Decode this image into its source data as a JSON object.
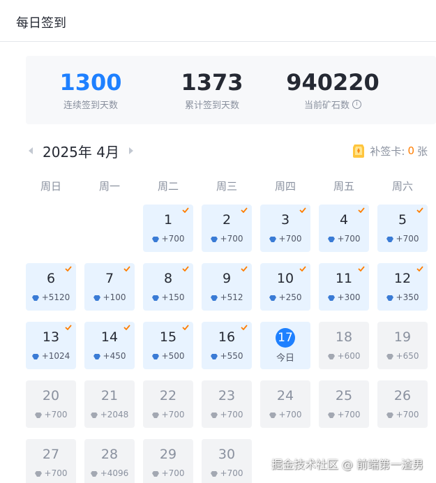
{
  "header": {
    "title": "每日签到"
  },
  "stats": {
    "consecutive": {
      "value": "1300",
      "label": "连续签到天数"
    },
    "total": {
      "value": "1373",
      "label": "累计签到天数"
    },
    "ore": {
      "value": "940220",
      "label": "当前矿石数",
      "info_icon": "info-circle-icon"
    }
  },
  "calendar": {
    "month_label": "2025年 4月",
    "prev_icon": "chevron-left-icon",
    "next_icon": "chevron-right-icon",
    "makeup": {
      "label": "补签卡:",
      "count": "0",
      "unit": "张"
    },
    "weekdays": [
      "周日",
      "周一",
      "周二",
      "周三",
      "周四",
      "周五",
      "周六"
    ],
    "today_label": "今日",
    "days": [
      {
        "day": "1",
        "reward": "+700",
        "status": "signed"
      },
      {
        "day": "2",
        "reward": "+700",
        "status": "signed"
      },
      {
        "day": "3",
        "reward": "+700",
        "status": "signed"
      },
      {
        "day": "4",
        "reward": "+700",
        "status": "signed"
      },
      {
        "day": "5",
        "reward": "+700",
        "status": "signed"
      },
      {
        "day": "6",
        "reward": "+5120",
        "status": "signed"
      },
      {
        "day": "7",
        "reward": "+100",
        "status": "signed"
      },
      {
        "day": "8",
        "reward": "+150",
        "status": "signed"
      },
      {
        "day": "9",
        "reward": "+512",
        "status": "signed"
      },
      {
        "day": "10",
        "reward": "+250",
        "status": "signed"
      },
      {
        "day": "11",
        "reward": "+300",
        "status": "signed"
      },
      {
        "day": "12",
        "reward": "+350",
        "status": "signed"
      },
      {
        "day": "13",
        "reward": "+1024",
        "status": "signed"
      },
      {
        "day": "14",
        "reward": "+450",
        "status": "signed"
      },
      {
        "day": "15",
        "reward": "+500",
        "status": "signed"
      },
      {
        "day": "16",
        "reward": "+550",
        "status": "signed"
      },
      {
        "day": "17",
        "reward": "",
        "status": "today"
      },
      {
        "day": "18",
        "reward": "+600",
        "status": "future"
      },
      {
        "day": "19",
        "reward": "+650",
        "status": "future"
      },
      {
        "day": "20",
        "reward": "+700",
        "status": "future"
      },
      {
        "day": "21",
        "reward": "+2048",
        "status": "future"
      },
      {
        "day": "22",
        "reward": "+700",
        "status": "future"
      },
      {
        "day": "23",
        "reward": "+700",
        "status": "future"
      },
      {
        "day": "24",
        "reward": "+700",
        "status": "future"
      },
      {
        "day": "25",
        "reward": "+700",
        "status": "future"
      },
      {
        "day": "26",
        "reward": "+700",
        "status": "future"
      },
      {
        "day": "27",
        "reward": "+700",
        "status": "future"
      },
      {
        "day": "28",
        "reward": "+4096",
        "status": "future"
      },
      {
        "day": "29",
        "reward": "+700",
        "status": "future"
      },
      {
        "day": "30",
        "reward": "+700",
        "status": "future"
      }
    ]
  },
  "watermark": "掘金技术社区 @ 前端第一渣男",
  "colors": {
    "accent": "#1e80ff",
    "signed_bg": "#e8f3ff",
    "future_bg": "#f2f3f5",
    "check": "#ff7d00"
  }
}
